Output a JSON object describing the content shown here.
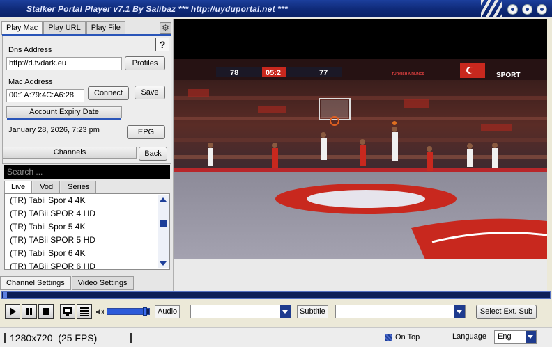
{
  "window": {
    "title": "Stalker Portal Player v7.1 By Salibaz   *** http://uyduportal.net ***"
  },
  "left": {
    "tabs": [
      "Play Mac",
      "Play URL",
      "Play File"
    ],
    "help_label": "?",
    "dns_label": "Dns Address",
    "dns_value": "http://d.tvdark.eu",
    "profiles_label": "Profiles",
    "mac_label": "Mac Address",
    "mac_value": "00:1A:79:4C:A6:28",
    "connect_label": "Connect",
    "save_label": "Save",
    "expiry_header": "Account Expiry Date",
    "expiry_value": "January 28, 2026, 7:23 pm",
    "epg_label": "EPG",
    "channels_header": "Channels",
    "back_label": "Back",
    "search_placeholder": "Search ...",
    "subtabs": [
      "Live",
      "Vod",
      "Series"
    ],
    "channels": [
      "(TR) Tabii Spor 4 4K",
      "(TR) TABii SPOR 4 HD",
      "(TR) Tabii Spor 5 4K",
      "(TR) TABii SPOR 5 HD",
      "(TR) Tabii Spor 6 4K",
      "(TR) TABii SPOR 6 HD"
    ],
    "bottom_tabs": [
      "Channel Settings",
      "Video Settings"
    ]
  },
  "scoreboard": {
    "home_score": "78",
    "clock": "05:2",
    "away_score": "77",
    "sponsor": "TURKISH AIRLINES",
    "channel_logo": "SPORT"
  },
  "controls": {
    "audio_label": "Audio",
    "subtitle_label": "Subtitle",
    "select_sub_label": "Select Ext. Sub",
    "volume_fraction": 0.92,
    "seek_fraction": 0.0
  },
  "status": {
    "resolution": "1280x720",
    "fps": "(25 FPS)",
    "ontop_label": "On Top",
    "language_label": "Language",
    "language_value": "Eng"
  },
  "colors": {
    "title_blue": "#1c3f9c",
    "accent_blue": "#2a55b8",
    "court_red": "#c8281e"
  }
}
